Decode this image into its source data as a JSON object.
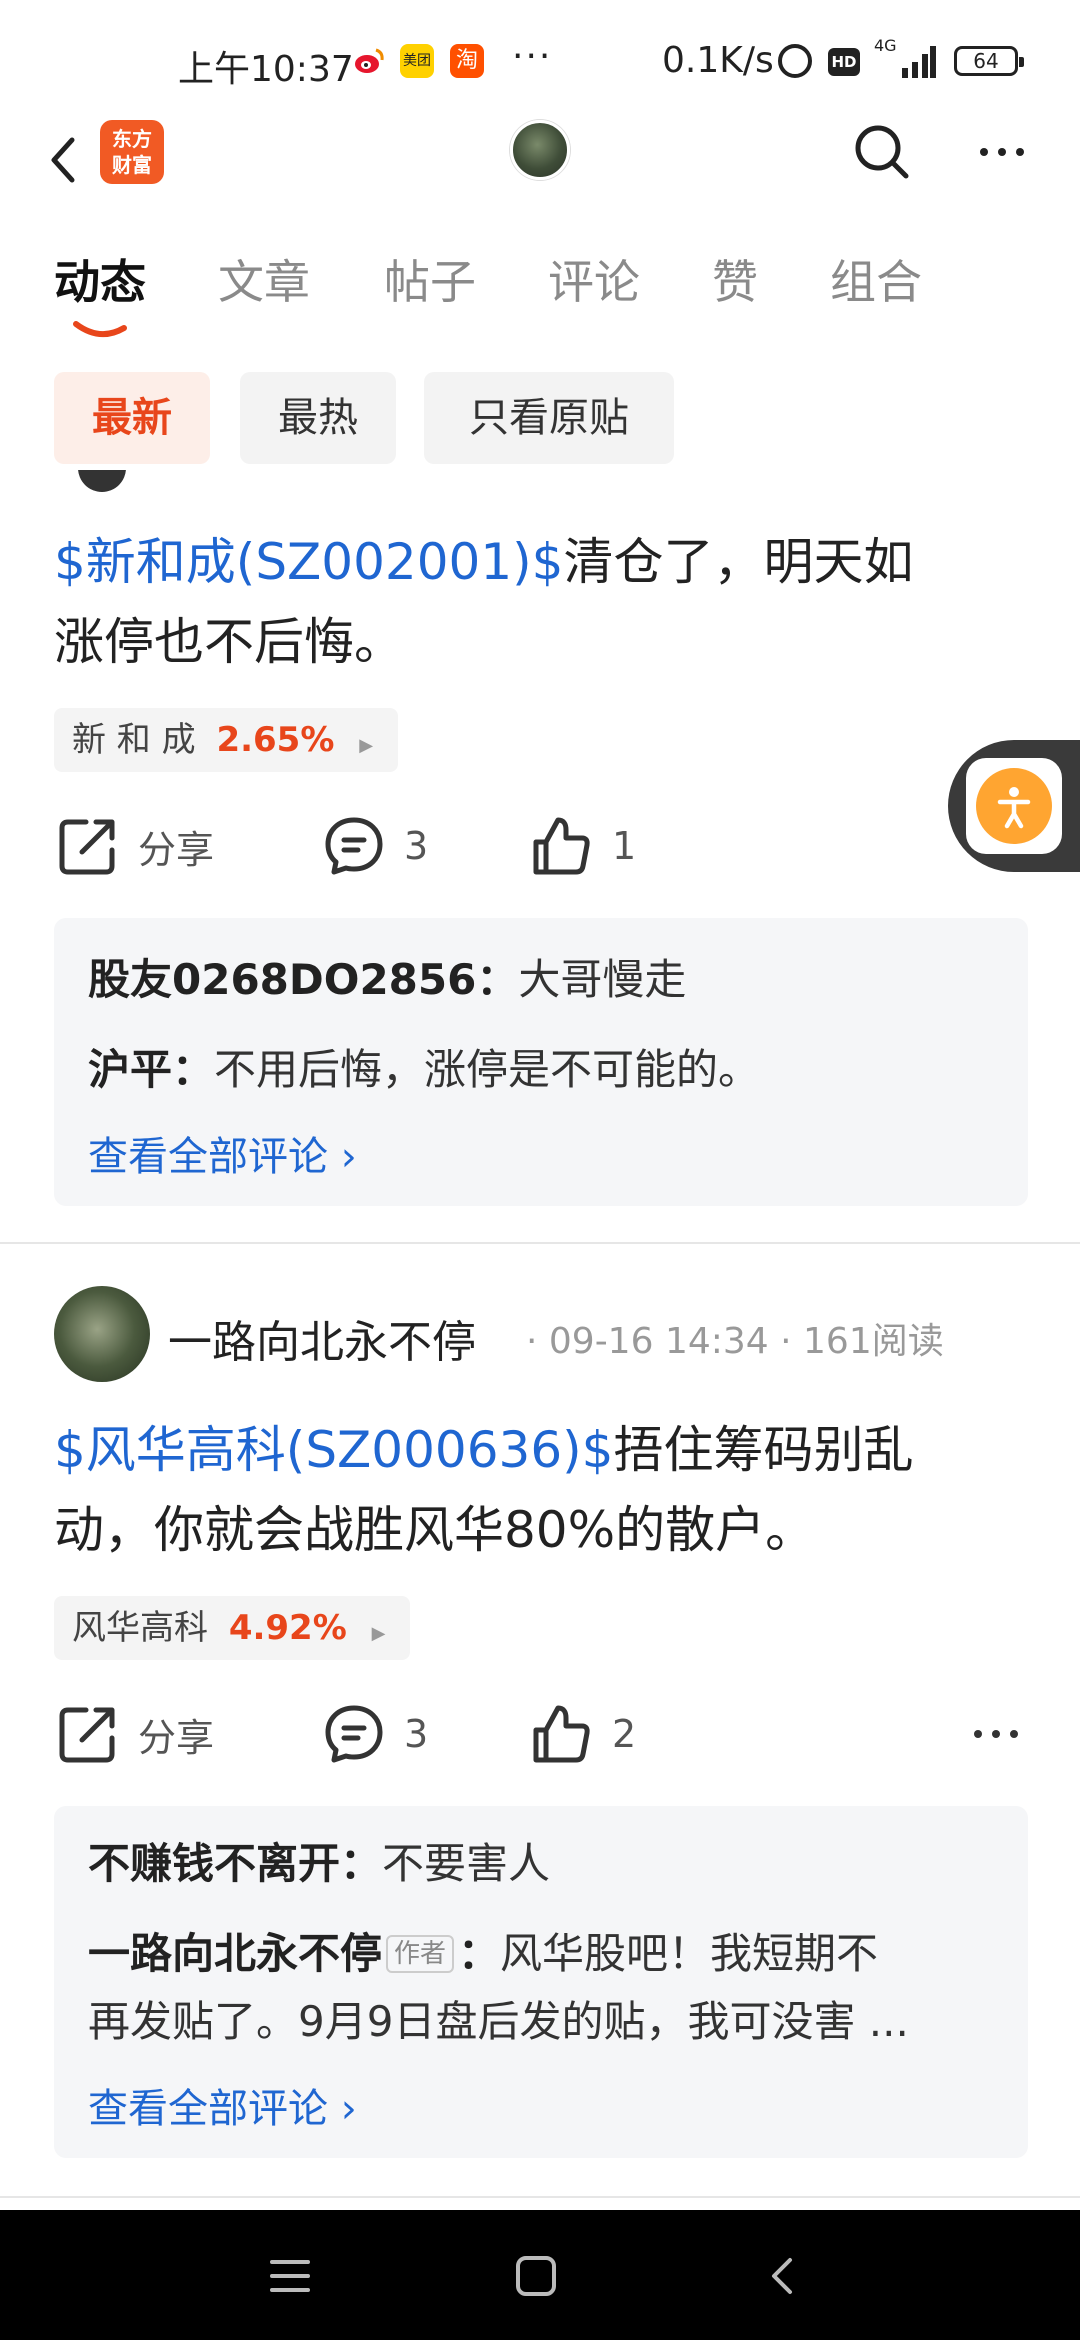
{
  "status_bar": {
    "time": "上午10:37",
    "icons": [
      "weibo-icon",
      "meituan-icon",
      "taobao-icon"
    ],
    "meituan_label": "美团",
    "taobao_label": "淘",
    "more": "···",
    "net_speed": "0.1K/s",
    "network": "4G",
    "battery": "64"
  },
  "header": {
    "logo_line1": "东方",
    "logo_line2": "财富"
  },
  "tabs": [
    "动态",
    "文章",
    "帖子",
    "评论",
    "赞",
    "组合"
  ],
  "filters": [
    "最新",
    "最热",
    "只看原贴"
  ],
  "posts": [
    {
      "stock_link": "$新和成(SZ002001)$",
      "text_line1_rest": "清仓了，明天如",
      "text_line2": "涨停也不后悔。",
      "tag_name": "新 和 成",
      "tag_pct": "2.65%",
      "share": "分享",
      "comments": "3",
      "likes": "1",
      "comment_items": [
        {
          "name": "股友0268DO2856",
          "sep": "：",
          "text": "大哥慢走"
        },
        {
          "name": "沪平",
          "sep": "：",
          "text": "不用后悔，涨停是不可能的。"
        }
      ],
      "view_all": "查看全部评论 ›"
    },
    {
      "user_name": "一路向北永不停",
      "meta": "· 09-16 14:34 · 161阅读",
      "stock_link": "$风华高科(SZ000636)$",
      "text_line1_rest": "捂住筹码别乱",
      "text_line2": "动，你就会战胜风华80%的散户。",
      "tag_name": "风华高科",
      "tag_pct": "4.92%",
      "share": "分享",
      "comments": "3",
      "likes": "2",
      "comment_items": [
        {
          "name": "不赚钱不离开",
          "sep": "：",
          "text": "不要害人"
        },
        {
          "name": "一路向北永不停",
          "badge": "作者",
          "sep": "：",
          "text": "风华股吧！我短期不",
          "text2": "再发贴了。9月9日盘后发的贴，我可没害  ..."
        }
      ],
      "view_all": "查看全部评论 ›"
    }
  ],
  "colors": {
    "accent": "#e8461b",
    "link": "#1f66d1",
    "logo": "#f15a24",
    "float_button": "#ffa531"
  }
}
